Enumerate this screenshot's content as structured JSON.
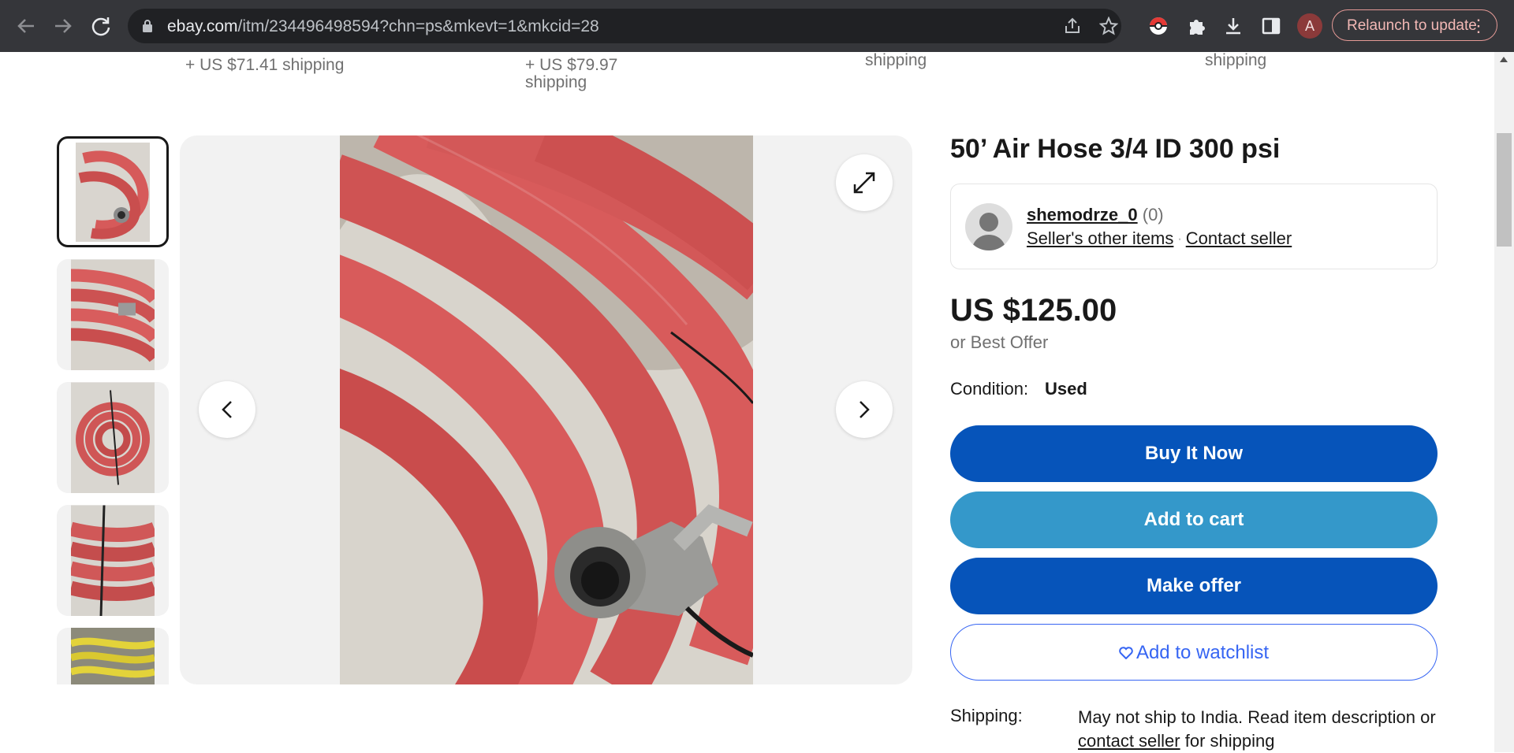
{
  "browser": {
    "url_host": "ebay.com",
    "url_path": "/itm/234496498594?chn=ps&mkevt=1&mkcid=28",
    "profile_initial": "A",
    "relaunch_label": "Relaunch to update",
    "icons": [
      "back-arrow-icon",
      "forward-arrow-icon",
      "reload-icon",
      "lock-icon",
      "share-icon",
      "star-icon",
      "pokeball-extension-icon",
      "puzzle-extensions-icon",
      "download-icon",
      "side-panel-icon",
      "kebab-menu-icon"
    ]
  },
  "related_strip": {
    "item1_shipping": "+ US $71.41 shipping",
    "item2_shipping_line1": "+ US $79.97",
    "item2_shipping_line2": "shipping",
    "item3_shipping": "shipping",
    "item4_shipping": "shipping"
  },
  "listing": {
    "title": "50’ Air Hose 3/4 ID 300 psi",
    "seller": {
      "name": "shemodrze_0",
      "feedback": "(0)",
      "other_items": "Seller's other items",
      "separator": "·",
      "contact": "Contact seller"
    },
    "price": "US $125.00",
    "best_offer": "or Best Offer",
    "condition_label": "Condition:",
    "condition_value": "Used",
    "buttons": {
      "buy_now": "Buy It Now",
      "add_to_cart": "Add to cart",
      "make_offer": "Make offer",
      "watchlist": "Add to watchlist"
    },
    "shipping_label": "Shipping:",
    "shipping_text_1": "May not ship to India. Read item description or ",
    "shipping_link": "contact seller",
    "shipping_text_2": " for shipping"
  },
  "colors": {
    "primary_button": "#0654ba",
    "secondary_button": "#3498ca",
    "link_blue": "#3665f3",
    "hose_red": "#d95f5f"
  }
}
